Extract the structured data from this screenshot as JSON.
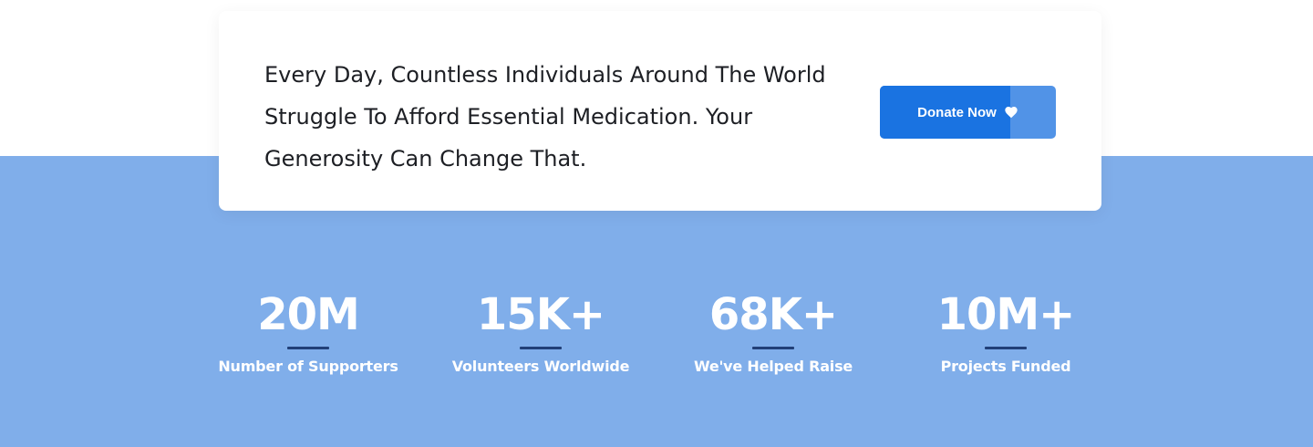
{
  "cta": {
    "text": "Every Day, Countless Individuals Around The World Struggle To Afford Essential Medication. Your Generosity Can Change That.",
    "button_label": "Donate Now",
    "button_icon": "heart-icon",
    "button_fill_fraction": 0.74
  },
  "colors": {
    "band": "#80aeea",
    "button_primary": "#1a73e1",
    "button_secondary": "#5193e7",
    "stat_divider": "#213f78",
    "text_dark": "#1d1f24"
  },
  "stats": [
    {
      "value": "20M",
      "label": "Number of Supporters"
    },
    {
      "value": "15K+",
      "label": "Volunteers Worldwide"
    },
    {
      "value": "68K+",
      "label": "We've Helped Raise"
    },
    {
      "value": "10M+",
      "label": "Projects Funded"
    }
  ]
}
